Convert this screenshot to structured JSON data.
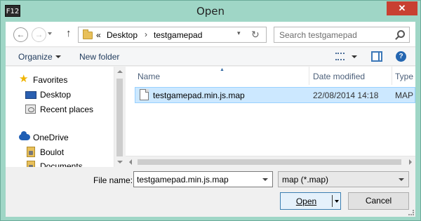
{
  "window": {
    "app_icon_label": "F12",
    "title": "Open",
    "close_glyph": "✕"
  },
  "navigation": {
    "back_glyph": "←",
    "forward_glyph": "→",
    "up_glyph": "↑",
    "address": {
      "overflow_glyph": "«",
      "separator_glyph": "›",
      "crumbs": [
        "Desktop",
        "testgamepad"
      ],
      "dropdown_glyph": "▾",
      "refresh_glyph": "↻"
    },
    "search": {
      "placeholder": "Search testgamepad",
      "icon": "search-icon"
    }
  },
  "command_bar": {
    "organize_label": "Organize",
    "new_folder_label": "New folder",
    "icons": [
      "view-list-icon",
      "preview-pane-icon",
      "help-icon"
    ],
    "help_glyph": "?"
  },
  "nav_pane": {
    "items": [
      {
        "label": "Favorites",
        "icon": "star-icon"
      },
      {
        "label": "Desktop",
        "icon": "desktop-icon"
      },
      {
        "label": "Recent places",
        "icon": "recent-places-icon"
      },
      {
        "label": "OneDrive",
        "icon": "cloud-icon"
      },
      {
        "label": "Boulot",
        "icon": "locked-folder-icon"
      },
      {
        "label": "Documents",
        "icon": "locked-folder-icon"
      }
    ]
  },
  "file_list": {
    "sort_glyph": "▲",
    "columns": [
      "Name",
      "Date modified",
      "Type"
    ],
    "rows": [
      {
        "name": "testgamepad.min.js.map",
        "date": "22/08/2014 14:18",
        "type": "MAP File",
        "selected": true
      }
    ]
  },
  "footer": {
    "file_name_label": "File name:",
    "file_name_value": "testgamepad.min.js.map",
    "filter_value": "map (*.map)",
    "open_label": "Open",
    "cancel_label": "Cancel"
  },
  "colors": {
    "frame": "#9fd6c6",
    "close_button": "#c84031",
    "selection": "#cce8ff",
    "selection_border": "#99d1ff",
    "accent_link": "#1e395b"
  }
}
